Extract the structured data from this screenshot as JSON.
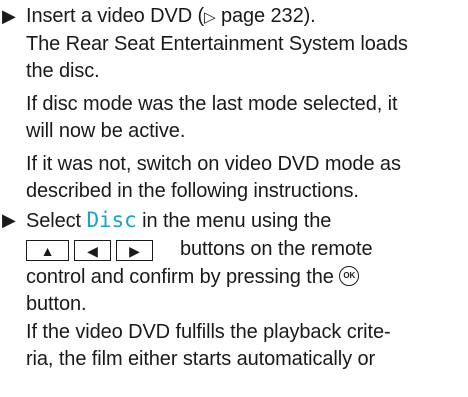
{
  "step1": {
    "prefix": "Insert a video DVD (",
    "page_ref": "page 232",
    "suffix": ").",
    "l2": "The Rear Seat Entertainment System loads",
    "l3": "the disc."
  },
  "para1": {
    "l1": "If disc mode was the last mode selected, it",
    "l2": "will now be active."
  },
  "para2": {
    "l1": "If it was not, switch on video DVD mode as",
    "l2": "described in the following instructions."
  },
  "step2": {
    "select": "Select",
    "disc": "Disc",
    "in_menu": "in the menu using the",
    "up_symbol": "▲",
    "left_symbol": "◀",
    "right_symbol": "▶",
    "buttons_tail": "buttons on the remote",
    "control": "control and confirm by pressing the",
    "ok_label": "OK",
    "button_word": "button.",
    "l5": "If the video DVD fulfills the playback crite-",
    "l6": "ria, the film either starts automatically or"
  },
  "icons": {
    "bullet": "▶",
    "page_arrow": "▷"
  },
  "colors": {
    "disc_highlight": "#1aa3c9",
    "text": "#1a1a1a"
  }
}
